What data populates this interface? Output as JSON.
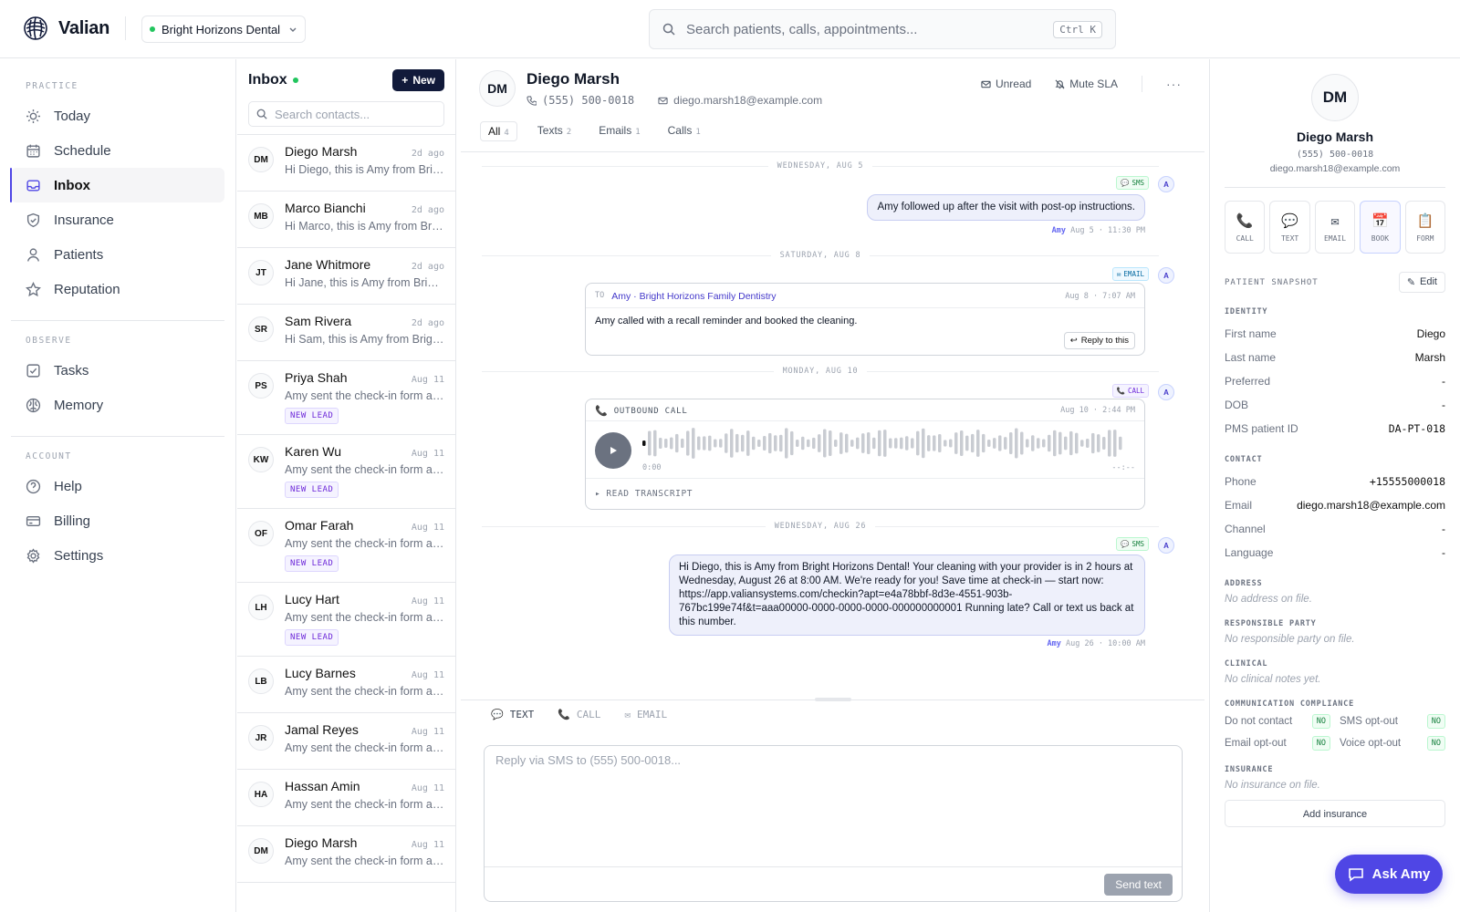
{
  "app": {
    "name": "Valian",
    "practice": "Bright Horizons Dental"
  },
  "search": {
    "placeholder": "Search patients, calls, appointments...",
    "shortcut": "Ctrl K"
  },
  "nav": {
    "sections": [
      {
        "label": "PRACTICE",
        "items": [
          {
            "label": "Today",
            "icon": "sun-icon"
          },
          {
            "label": "Schedule",
            "icon": "calendar-icon"
          },
          {
            "label": "Inbox",
            "icon": "inbox-icon",
            "active": true
          },
          {
            "label": "Insurance",
            "icon": "shield-icon"
          },
          {
            "label": "Patients",
            "icon": "user-icon"
          },
          {
            "label": "Reputation",
            "icon": "star-icon"
          }
        ]
      },
      {
        "label": "OBSERVE",
        "items": [
          {
            "label": "Tasks",
            "icon": "checkbox-icon"
          },
          {
            "label": "Memory",
            "icon": "brain-icon"
          }
        ]
      },
      {
        "label": "ACCOUNT",
        "items": [
          {
            "label": "Help",
            "icon": "help-icon"
          },
          {
            "label": "Billing",
            "icon": "card-icon"
          },
          {
            "label": "Settings",
            "icon": "gear-icon"
          }
        ]
      }
    ]
  },
  "inbox": {
    "title": "Inbox",
    "new_label": "New",
    "search_placeholder": "Search contacts...",
    "items": [
      {
        "initials": "DM",
        "name": "Diego Marsh",
        "time": "2d ago",
        "snippet": "Hi Diego, this is Amy from Bright Horizons Dental!",
        "tag": ""
      },
      {
        "initials": "MB",
        "name": "Marco Bianchi",
        "time": "2d ago",
        "snippet": "Hi Marco, this is Amy from Bright Horizons Dental!",
        "tag": ""
      },
      {
        "initials": "JT",
        "name": "Jane Whitmore",
        "time": "2d ago",
        "snippet": "Hi Jane, this is Amy from Bright Horizons Dental!",
        "tag": ""
      },
      {
        "initials": "SR",
        "name": "Sam Rivera",
        "time": "2d ago",
        "snippet": "Hi Sam, this is Amy from Bright Horizons Dental!",
        "tag": ""
      },
      {
        "initials": "PS",
        "name": "Priya Shah",
        "time": "Aug 11",
        "snippet": "Amy sent the check-in form and confirmed the visit.",
        "tag": "NEW LEAD"
      },
      {
        "initials": "KW",
        "name": "Karen Wu",
        "time": "Aug 11",
        "snippet": "Amy sent the check-in form and confirmed the visit.",
        "tag": "NEW LEAD"
      },
      {
        "initials": "OF",
        "name": "Omar Farah",
        "time": "Aug 11",
        "snippet": "Amy sent the check-in form and confirmed the visit.",
        "tag": "NEW LEAD"
      },
      {
        "initials": "LH",
        "name": "Lucy Hart",
        "time": "Aug 11",
        "snippet": "Amy sent the check-in form and confirmed the visit.",
        "tag": "NEW LEAD"
      },
      {
        "initials": "LB",
        "name": "Lucy Barnes",
        "time": "Aug 11",
        "snippet": "Amy sent the check-in form and confirmed the visit.",
        "tag": ""
      },
      {
        "initials": "JR",
        "name": "Jamal Reyes",
        "time": "Aug 11",
        "snippet": "Amy sent the check-in form and confirmed the visit.",
        "tag": ""
      },
      {
        "initials": "HA",
        "name": "Hassan Amin",
        "time": "Aug 11",
        "snippet": "Amy sent the check-in form and confirmed the visit.",
        "tag": ""
      },
      {
        "initials": "DM",
        "name": "Diego Marsh",
        "time": "Aug 11",
        "snippet": "Amy sent the check-in form and confirmed the visit.",
        "tag": ""
      }
    ]
  },
  "conversation": {
    "initials": "DM",
    "name": "Diego Marsh",
    "phone": "(555) 500-0018",
    "email": "diego.marsh18@example.com",
    "actions": {
      "unread": "Unread",
      "mute": "Mute SLA"
    },
    "tabs": [
      {
        "label": "All",
        "count": "4",
        "active": true
      },
      {
        "label": "Texts",
        "count": "2"
      },
      {
        "label": "Emails",
        "count": "1"
      },
      {
        "label": "Calls",
        "count": "1"
      }
    ],
    "days": [
      "WEDNESDAY, AUG 5",
      "SATURDAY, AUG 8",
      "MONDAY, AUG 10",
      "WEDNESDAY, AUG 26"
    ],
    "msg1": {
      "badge": "SMS",
      "avatar": "A",
      "text": "Amy followed up after the visit with post-op instructions.",
      "author": "Amy",
      "time": "Aug 5 · 11:30 PM"
    },
    "msg2": {
      "badge": "EMAIL",
      "avatar": "A",
      "to_label": "TO",
      "to": "Amy · Bright Horizons Family Dentistry",
      "time": "Aug 8 · 7:07 AM",
      "text": "Amy called with a recall reminder and booked the cleaning.",
      "reply": "Reply to this"
    },
    "msg3": {
      "badge": "CALL",
      "avatar": "A",
      "title": "OUTBOUND CALL",
      "time": "Aug 10 · 2:44 PM",
      "elapsed": "0:00",
      "duration": "--:--",
      "transcript": "READ TRANSCRIPT"
    },
    "msg4": {
      "badge": "SMS",
      "avatar": "A",
      "text": "Hi Diego, this is Amy from Bright Horizons Dental! Your cleaning with your provider is in 2 hours at Wednesday, August 26 at 8:00 AM. We're ready for you! Save time at check-in — start now: https://app.valiansystems.com/checkin?apt=e4a78bbf-8d3e-4551-903b-767bc199e74f&t=aaa00000-0000-0000-0000-000000000001 Running late? Call or text us back at this number.",
      "author": "Amy",
      "time": "Aug 26 · 10:00 AM"
    },
    "composer": {
      "tabs": [
        "TEXT",
        "CALL",
        "EMAIL"
      ],
      "placeholder": "Reply via SMS to (555) 500-0018...",
      "send": "Send text"
    }
  },
  "patient": {
    "initials": "DM",
    "name": "Diego Marsh",
    "phone": "(555) 500-0018",
    "email": "diego.marsh18@example.com",
    "quick_actions": [
      "CALL",
      "TEXT",
      "EMAIL",
      "BOOK",
      "FORM"
    ],
    "snapshot_label": "PATIENT SNAPSHOT",
    "edit_label": "Edit",
    "identity": {
      "label": "IDENTITY",
      "rows": [
        [
          "First name",
          "Diego"
        ],
        [
          "Last name",
          "Marsh"
        ],
        [
          "Preferred",
          "-"
        ],
        [
          "DOB",
          "-"
        ],
        [
          "PMS patient ID",
          "DA-PT-018"
        ]
      ]
    },
    "contact": {
      "label": "CONTACT",
      "rows": [
        [
          "Phone",
          "+15555000018"
        ],
        [
          "Email",
          "diego.marsh18@example.com"
        ],
        [
          "Channel",
          "-"
        ],
        [
          "Language",
          "-"
        ]
      ]
    },
    "address": {
      "label": "ADDRESS",
      "empty": "No address on file."
    },
    "responsible": {
      "label": "RESPONSIBLE PARTY",
      "empty": "No responsible party on file."
    },
    "clinical": {
      "label": "CLINICAL",
      "empty": "No clinical notes yet."
    },
    "compliance": {
      "label": "COMMUNICATION COMPLIANCE",
      "items": [
        [
          "Do not contact",
          "NO"
        ],
        [
          "SMS opt-out",
          "NO"
        ],
        [
          "Email opt-out",
          "NO"
        ],
        [
          "Voice opt-out",
          "NO"
        ]
      ]
    },
    "insurance": {
      "label": "INSURANCE",
      "empty": "No insurance on file.",
      "add": "Add insurance"
    }
  },
  "ask_amy": "Ask Amy",
  "colors": {
    "accent": "#4f46e5",
    "navy": "#111a3a",
    "bubble": "#eef0fb"
  }
}
